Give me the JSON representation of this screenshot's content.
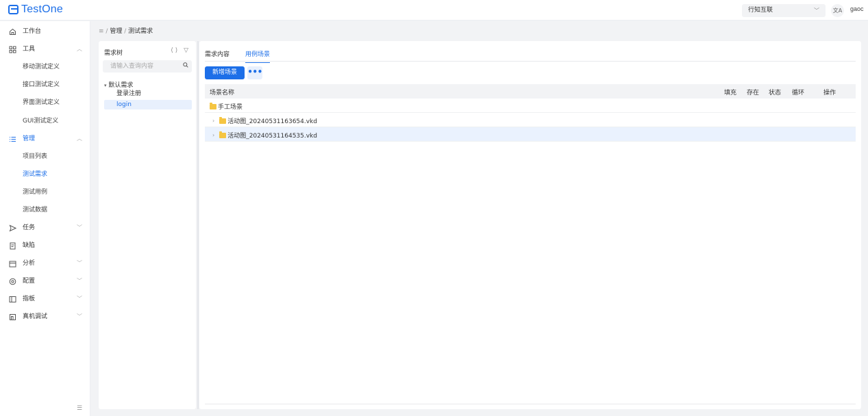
{
  "app": {
    "logo_text": "TestOne"
  },
  "header": {
    "org_select": "行知互联",
    "lang_icon": "translate-icon",
    "lang_label": "文A",
    "user": "gaoc"
  },
  "sidebar": {
    "items": [
      {
        "label": "工作台",
        "icon": "home-icon"
      },
      {
        "label": "工具",
        "icon": "grid-icon",
        "expanded": true
      },
      {
        "label": "移动测试定义"
      },
      {
        "label": "接口测试定义"
      },
      {
        "label": "界面测试定义"
      },
      {
        "label": "GUI测试定义"
      },
      {
        "label": "管理",
        "icon": "list-icon",
        "expanded": true,
        "active": true
      },
      {
        "label": "项目列表"
      },
      {
        "label": "测试需求",
        "active": true
      },
      {
        "label": "测试用例"
      },
      {
        "label": "测试数据"
      },
      {
        "label": "任务",
        "icon": "send-icon"
      },
      {
        "label": "缺陷",
        "icon": "doc-icon"
      },
      {
        "label": "分析",
        "icon": "calendar-icon"
      },
      {
        "label": "配置",
        "icon": "settings-icon"
      },
      {
        "label": "指板",
        "icon": "board-icon"
      },
      {
        "label": "真机调试",
        "icon": "device-icon"
      }
    ],
    "collapse_icon": "menu-fold-icon",
    "collapse_glyph": "☰"
  },
  "breadcrumb": {
    "icon": "≡",
    "sep": "/",
    "parent": "管理",
    "current": "测试需求"
  },
  "tree": {
    "title": "需求树",
    "tools": "⟨⟩ ▽",
    "search_placeholder": "请输入查询内容",
    "root": "默认需求",
    "leaves": [
      "登录注册",
      "login"
    ]
  },
  "main": {
    "tabs": [
      "需求内容",
      "用例场景"
    ],
    "active_tab": "用例场景",
    "add_button": "新增场景",
    "more_button": "•••",
    "columns": {
      "name": "场景名称",
      "fill": "填充",
      "exist": "存在",
      "status": "状态",
      "loop": "循环",
      "action": "操作"
    },
    "rows": [
      {
        "name": "手工场景",
        "expandable": false
      },
      {
        "name": "活动图_20240531163654.vkd",
        "expandable": true
      },
      {
        "name": "活动图_20240531164535.vkd",
        "expandable": true
      }
    ]
  }
}
